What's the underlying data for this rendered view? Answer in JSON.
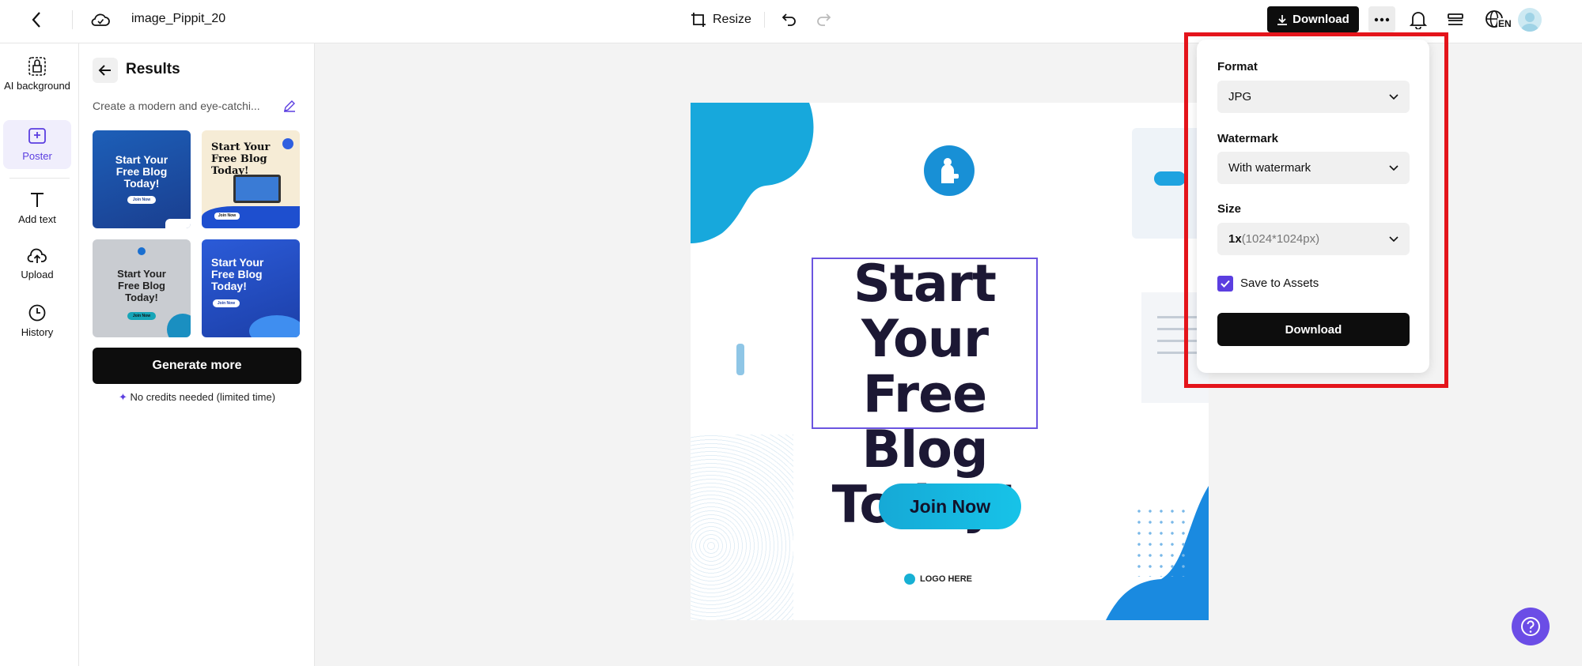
{
  "topbar": {
    "filename": "image_Pippit_20",
    "resize_label": "Resize",
    "download_label": "Download",
    "language": "EN"
  },
  "rail": {
    "items": [
      {
        "label": "AI background",
        "icon": "ai-background-icon"
      },
      {
        "label": "Poster",
        "icon": "poster-icon"
      },
      {
        "label": "Add text",
        "icon": "text-icon"
      },
      {
        "label": "Upload",
        "icon": "upload-cloud-icon"
      },
      {
        "label": "History",
        "icon": "clock-icon"
      }
    ]
  },
  "panel": {
    "title": "Results",
    "prompt": "Create a modern and eye-catchi...",
    "thumbnails": [
      {
        "title": "Start Your Free Blog Today!",
        "button": "Join Now"
      },
      {
        "title": "Start Your Free Blog Today!",
        "button": "Join Now"
      },
      {
        "title": "Start Your Free Blog Today!",
        "button": "Join Now"
      },
      {
        "title": "Start Your Free Blog Today!",
        "button": "Join Now"
      }
    ],
    "generate_label": "Generate more",
    "credits_note": "No credits needed (limited time)"
  },
  "poster": {
    "title": "Start Your Free Blog Today!",
    "cta": "Join Now",
    "logo": "LOGO HERE"
  },
  "download_panel": {
    "format_label": "Format",
    "format_value": "JPG",
    "watermark_label": "Watermark",
    "watermark_value": "With watermark",
    "size_label": "Size",
    "size_value_strong": "1x",
    "size_value_detail": "(1024*1024px)",
    "save_to_assets_label": "Save to Assets",
    "save_to_assets_checked": true,
    "download_label": "Download"
  },
  "colors": {
    "accent": "#5b3ee0",
    "highlight": "#e4141b",
    "poster_blue": "#1a9fd9",
    "poster_text": "#1c1834"
  }
}
